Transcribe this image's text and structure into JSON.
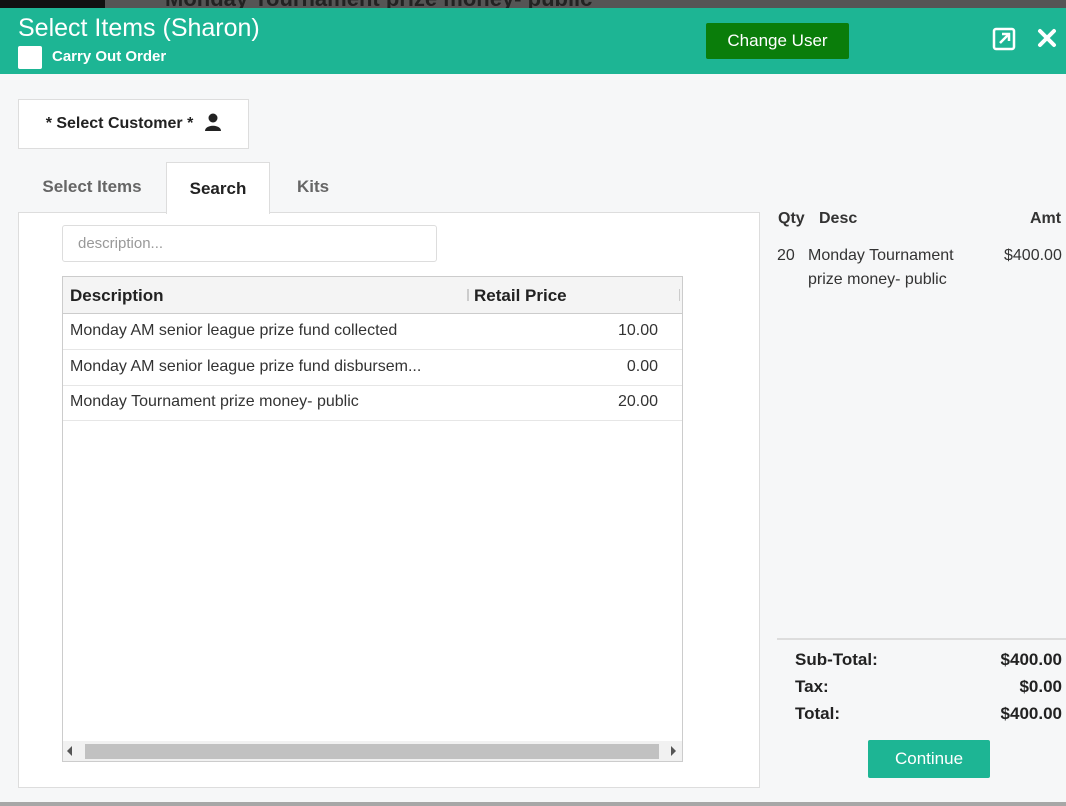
{
  "background": {
    "partial_title": "Monday Tournament prize money- public"
  },
  "header": {
    "title": "Select Items (Sharon)",
    "carry_out_label": "Carry Out Order",
    "change_user_label": "Change User",
    "bg_color": "#1db594",
    "change_user_color": "#0a7d0a",
    "icons": [
      "expand-icon",
      "close-icon"
    ]
  },
  "customer": {
    "select_label": "* Select Customer *",
    "icon": "user-icon"
  },
  "tabs": [
    {
      "label": "Select Items",
      "active": false
    },
    {
      "label": "Search",
      "active": true
    },
    {
      "label": "Kits",
      "active": false
    }
  ],
  "search": {
    "placeholder": "description...",
    "value": ""
  },
  "grid": {
    "columns": [
      "Description",
      "Retail Price"
    ],
    "rows": [
      {
        "description": "Monday AM senior league prize fund collected",
        "price": "10.00"
      },
      {
        "description": "Monday AM senior league prize fund disbursem...",
        "price": "0.00"
      },
      {
        "description": "Monday Tournament prize money- public",
        "price": "20.00"
      }
    ]
  },
  "cart": {
    "columns": [
      "Qty",
      "Desc",
      "Amt"
    ],
    "items": [
      {
        "qty": "20",
        "desc": "Monday Tournament prize money- public",
        "amt": "$400.00"
      }
    ],
    "subtotal_label": "Sub-Total:",
    "subtotal": "$400.00",
    "tax_label": "Tax:",
    "tax": "$0.00",
    "total_label": "Total:",
    "total": "$400.00"
  },
  "continue_label": "Continue"
}
